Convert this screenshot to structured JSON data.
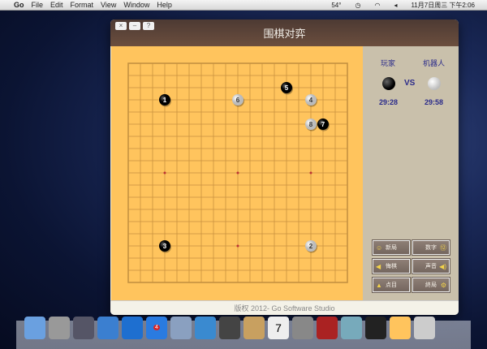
{
  "menubar": {
    "app": "Go",
    "items": [
      "File",
      "Edit",
      "Format",
      "View",
      "Window",
      "Help"
    ],
    "temp": "54°",
    "clock": "11月7日周三 下午2:06"
  },
  "window": {
    "title": "围棋对弈",
    "buttons": [
      "×",
      "–",
      "?"
    ],
    "footer": "版权 2012- Go Software Studio"
  },
  "players": {
    "player_label": "玩家",
    "computer_label": "机器人",
    "vs": "VS",
    "player_time": "29:28",
    "computer_time": "29:58"
  },
  "buttons": [
    {
      "label": "新局",
      "icon": "new-game-icon"
    },
    {
      "label": "数字",
      "icon": "number-icon"
    },
    {
      "label": "悔棋",
      "icon": "undo-icon"
    },
    {
      "label": "声音",
      "icon": "sound-icon"
    },
    {
      "label": "点目",
      "icon": "count-icon"
    },
    {
      "label": "終局",
      "icon": "end-icon"
    }
  ],
  "board": {
    "size": 19,
    "stones": [
      {
        "n": "1",
        "color": "black",
        "col": 3,
        "row": 3
      },
      {
        "n": "2",
        "color": "white",
        "col": 15,
        "row": 15
      },
      {
        "n": "3",
        "color": "black",
        "col": 3,
        "row": 15
      },
      {
        "n": "4",
        "color": "white",
        "col": 15,
        "row": 3
      },
      {
        "n": "5",
        "color": "black",
        "col": 13,
        "row": 2
      },
      {
        "n": "6",
        "color": "white",
        "col": 9,
        "row": 3
      },
      {
        "n": "7",
        "color": "black",
        "col": 16,
        "row": 5
      },
      {
        "n": "8",
        "color": "white",
        "col": 15,
        "row": 5
      }
    ]
  },
  "dock": [
    "finder",
    "launchpad",
    "mission-control",
    "xcode",
    "itunes",
    "app-store",
    "mail",
    "safari",
    "facetime",
    "address-book",
    "calendar",
    "system-preferences",
    "photo-booth",
    "network",
    "terminal",
    "go-app",
    "folder"
  ],
  "dock_badge": "4",
  "calendar_day": "7"
}
